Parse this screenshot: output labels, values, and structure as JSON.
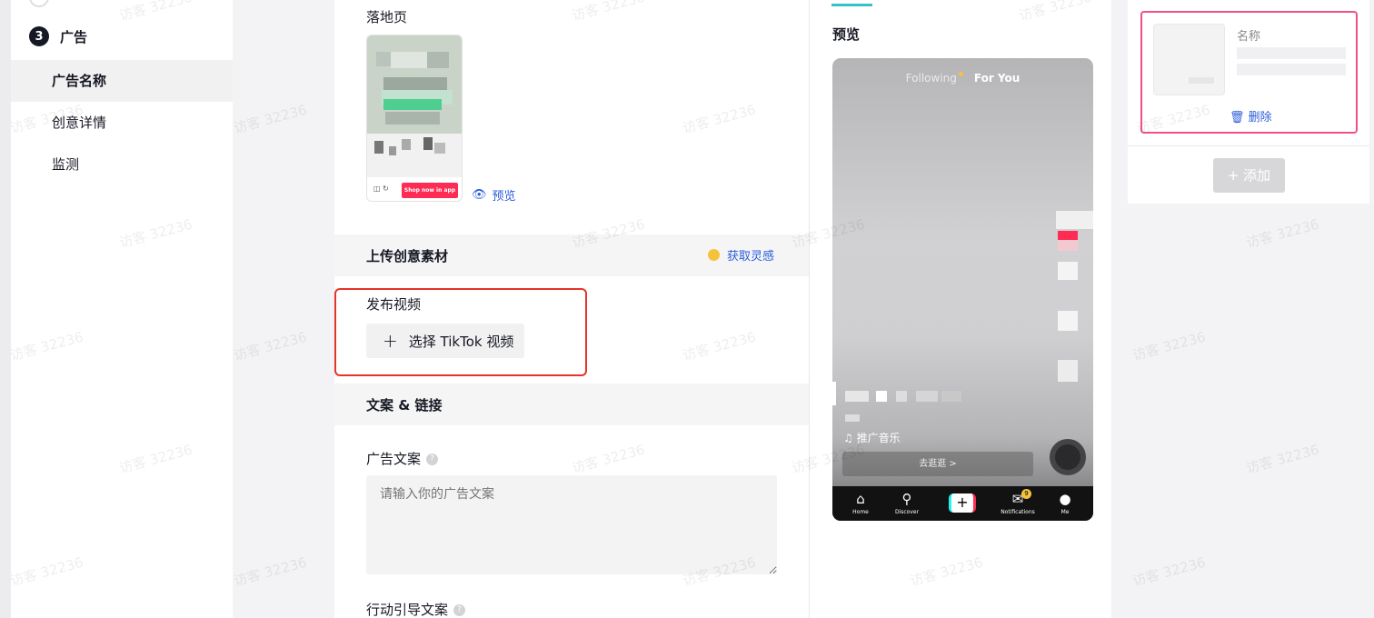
{
  "sidebar": {
    "step_number": "3",
    "step_label": "广告",
    "items": [
      {
        "label": "广告名称",
        "active": true
      },
      {
        "label": "创意详情",
        "active": false
      },
      {
        "label": "监测",
        "active": false
      }
    ]
  },
  "main": {
    "landing_label": "落地页",
    "landing_preview_link": "预览",
    "shop_button": "Shop now in app",
    "upload_section_title": "上传创意素材",
    "inspiration_link": "获取灵感",
    "publish_video_label": "发布视频",
    "select_video_button": "选择 TikTok 视频",
    "copy_section_title": "文案 & 链接",
    "ad_copy_label": "广告文案",
    "ad_copy_placeholder": "请输入你的广告文案",
    "cta_copy_label": "行动引导文案"
  },
  "preview": {
    "title": "预览",
    "tab_following": "Following",
    "tab_for_you": "For You",
    "music": "推广音乐",
    "go_button": "去逛逛 >",
    "nav": [
      {
        "label": "Home",
        "icon": "home-icon"
      },
      {
        "label": "Discover",
        "icon": "search-icon"
      },
      {
        "label": "Notifications",
        "icon": "inbox-icon",
        "badge": "9"
      },
      {
        "label": "Me",
        "icon": "profile-icon"
      }
    ]
  },
  "ad_card": {
    "name_label": "名称",
    "delete_label": "删除",
    "add_button": "+ 添加"
  },
  "watermark": "访客 32236",
  "colors": {
    "accent_blue": "#2b5dd9",
    "selection_red": "#e5342a",
    "card_pink": "#f0508a",
    "tiktok_red": "#fe2c55",
    "tab_teal": "#36c0c7"
  }
}
